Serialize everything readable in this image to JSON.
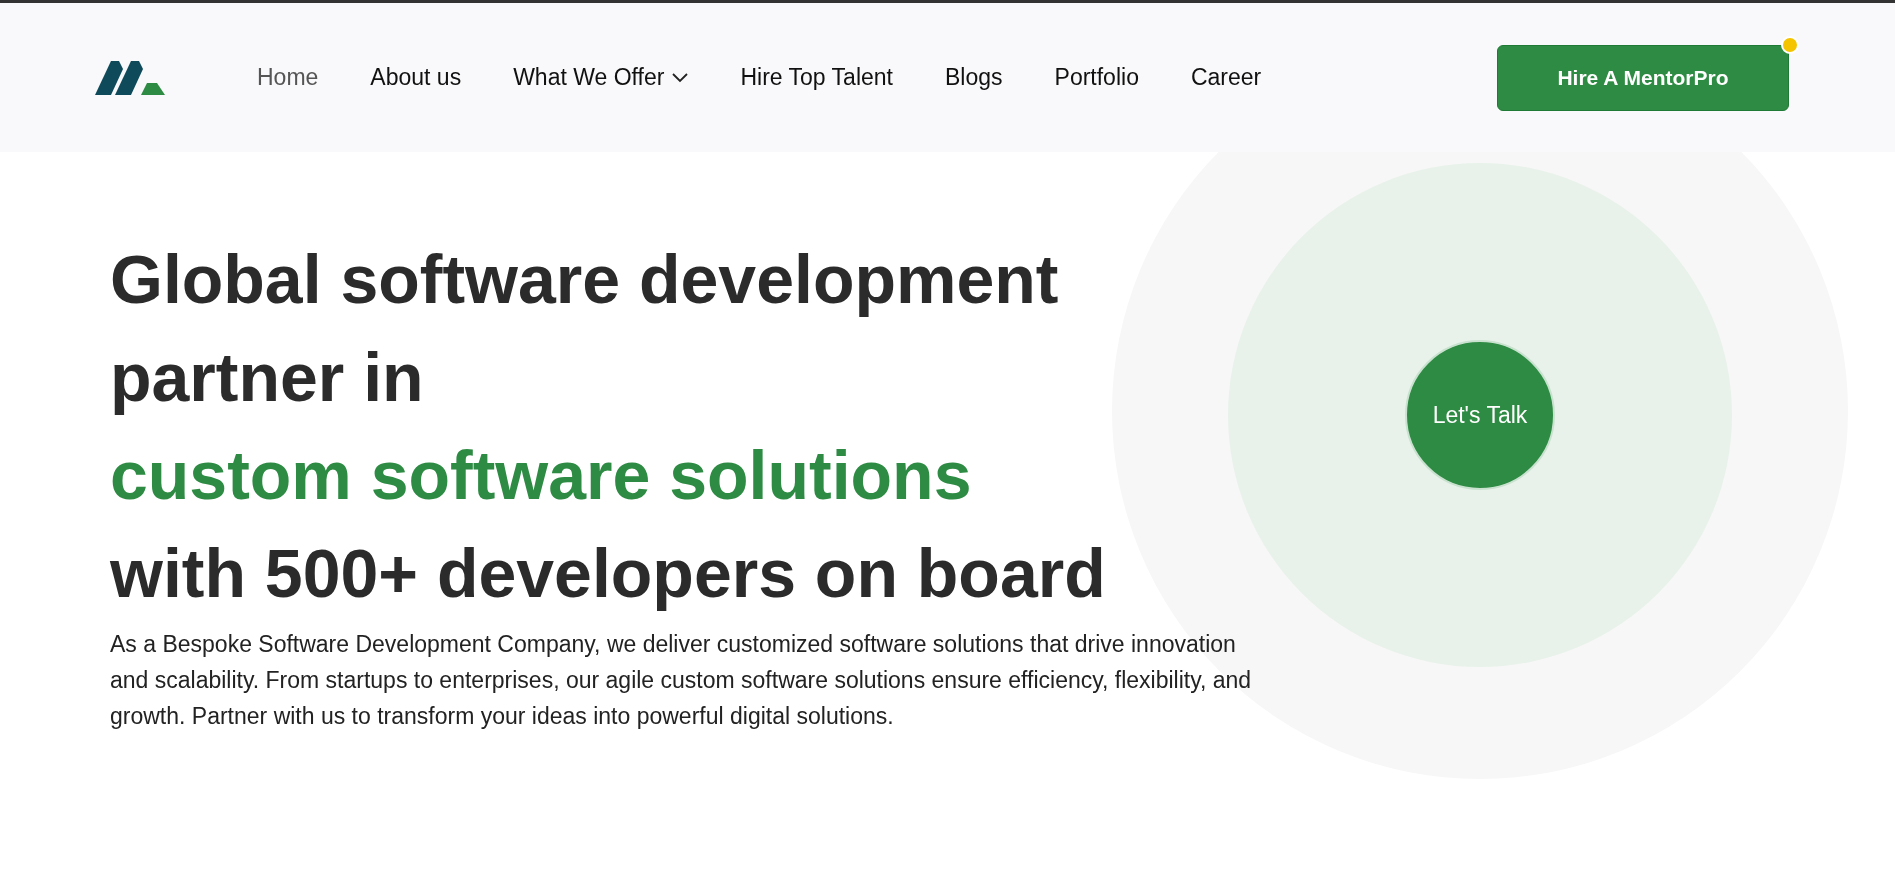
{
  "nav": {
    "items": [
      {
        "label": "Home",
        "selected": true,
        "dropdown": false
      },
      {
        "label": "About us",
        "selected": false,
        "dropdown": false
      },
      {
        "label": "What We Offer",
        "selected": false,
        "dropdown": true
      },
      {
        "label": "Hire Top Talent",
        "selected": false,
        "dropdown": false
      },
      {
        "label": "Blogs",
        "selected": false,
        "dropdown": false
      },
      {
        "label": "Portfolio",
        "selected": false,
        "dropdown": false
      },
      {
        "label": "Career",
        "selected": false,
        "dropdown": false
      }
    ],
    "cta": {
      "label": "Hire A MentorPro",
      "notification": true
    }
  },
  "hero": {
    "headline": [
      {
        "text": "Global software development",
        "highlight": false
      },
      {
        "text": "partner in",
        "highlight": false
      },
      {
        "text": "custom software solutions",
        "highlight": true
      },
      {
        "text": "with 500+ developers on board",
        "highlight": false
      }
    ],
    "description": "As a Bespoke Software Development Company, we deliver customized software solutions that drive innovation and scalability. From startups to enterprises, our agile custom software solutions ensure efficiency, flexibility, and growth. Partner with us to transform your ideas into powerful digital solutions.",
    "talk_button": "Let's Talk"
  }
}
